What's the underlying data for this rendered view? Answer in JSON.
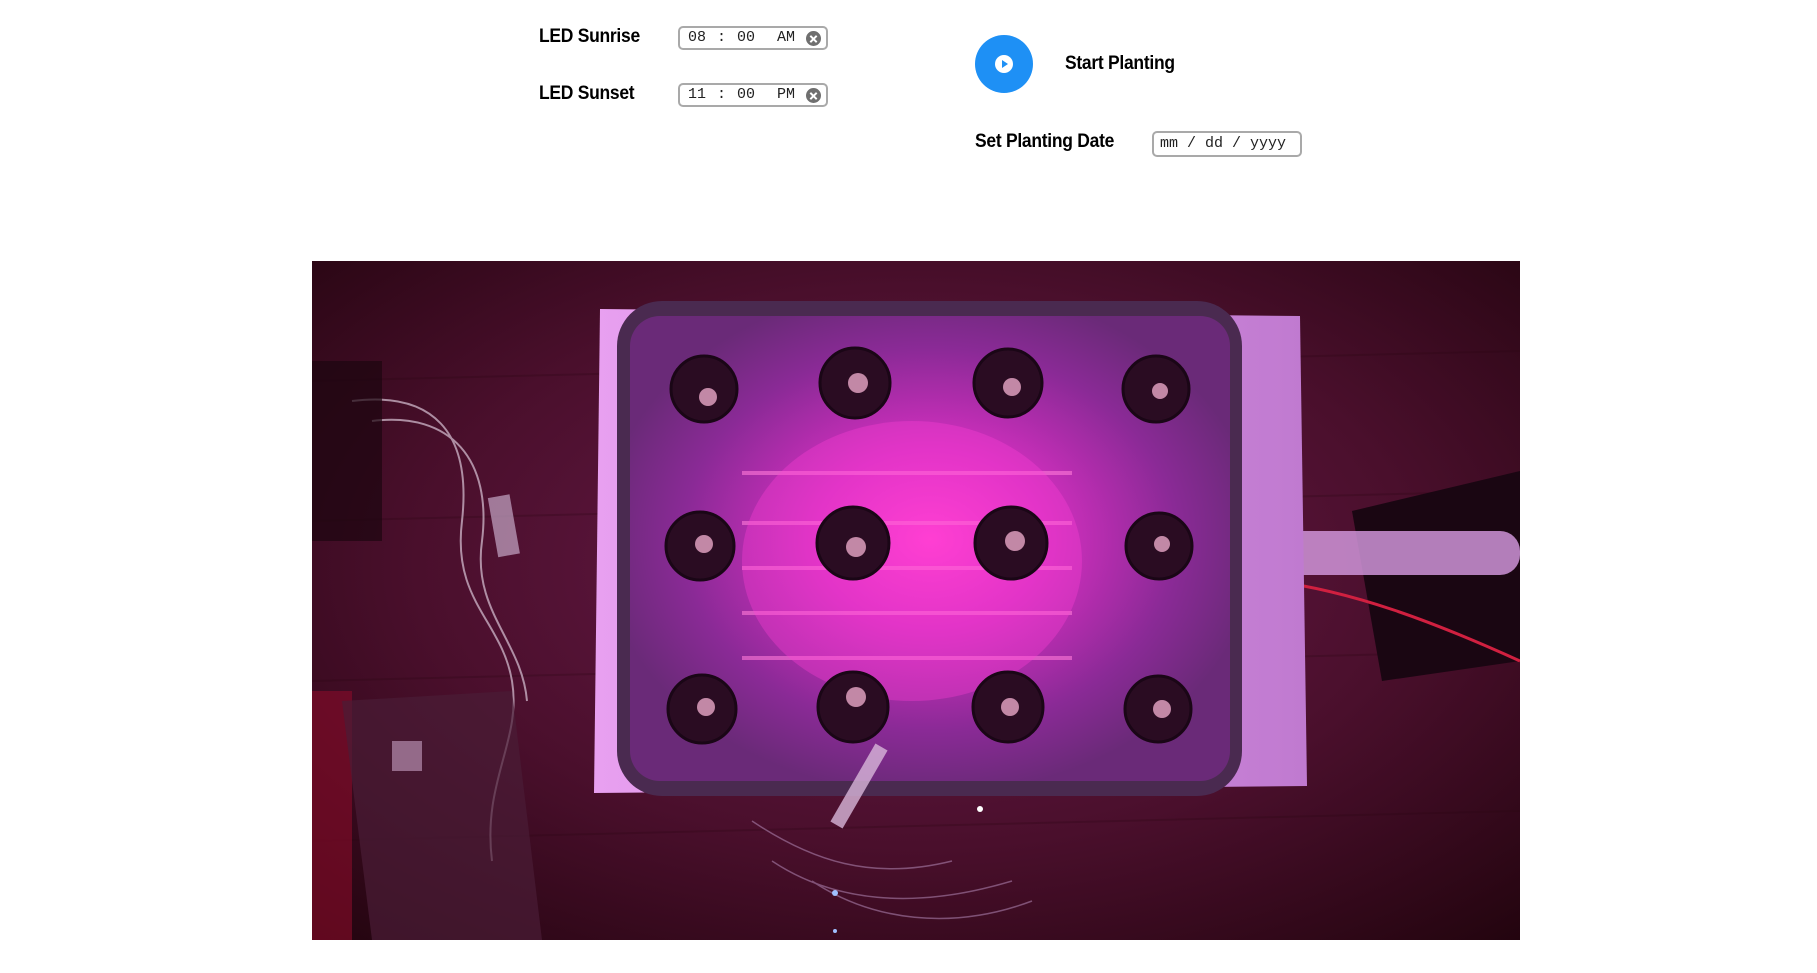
{
  "schedule": {
    "sunrise": {
      "label": "LED Sunrise",
      "value": "08 : 00  AM"
    },
    "sunset": {
      "label": "LED Sunset",
      "value": "11 : 00  PM"
    }
  },
  "planting": {
    "start_label": "Start Planting",
    "date_label": "Set Planting Date",
    "date_placeholder": "mm / dd / yyyy"
  },
  "colors": {
    "accent": "#1e90f5",
    "input_border": "#a9a9a9"
  },
  "camera": {
    "description_icon": "camera-feed"
  }
}
